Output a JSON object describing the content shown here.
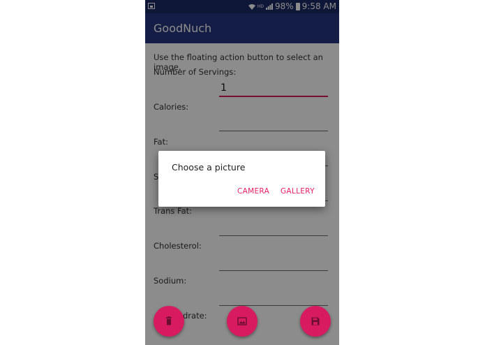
{
  "status_bar": {
    "hd_label": "HD",
    "battery": "98%",
    "time": "9:58 AM"
  },
  "app": {
    "title": "GoodNuch"
  },
  "form": {
    "instruction": "Use the floating action button to select an image.",
    "servings_label": "Number of Servings:",
    "servings_value": "1",
    "calories_label": "Calories:",
    "fat_label": "Fat:",
    "saturated_fat_label_partial": "S",
    "trans_fat_label": "Trans Fat:",
    "cholesterol_label": "Cholesterol:",
    "sodium_label": "Sodium:",
    "carbohydrate_label_partial": "drate:"
  },
  "dialog": {
    "title": "Choose a picture",
    "camera_label": "CAMERA",
    "gallery_label": "GALLERY"
  },
  "fabs": [
    {
      "icon": "delete-icon"
    },
    {
      "icon": "image-icon"
    },
    {
      "icon": "save-icon"
    }
  ],
  "colors": {
    "status_bar": "#1c2a66",
    "app_bar": "#26367e",
    "accent": "#d81b60",
    "dialog_button": "#e91e63"
  }
}
